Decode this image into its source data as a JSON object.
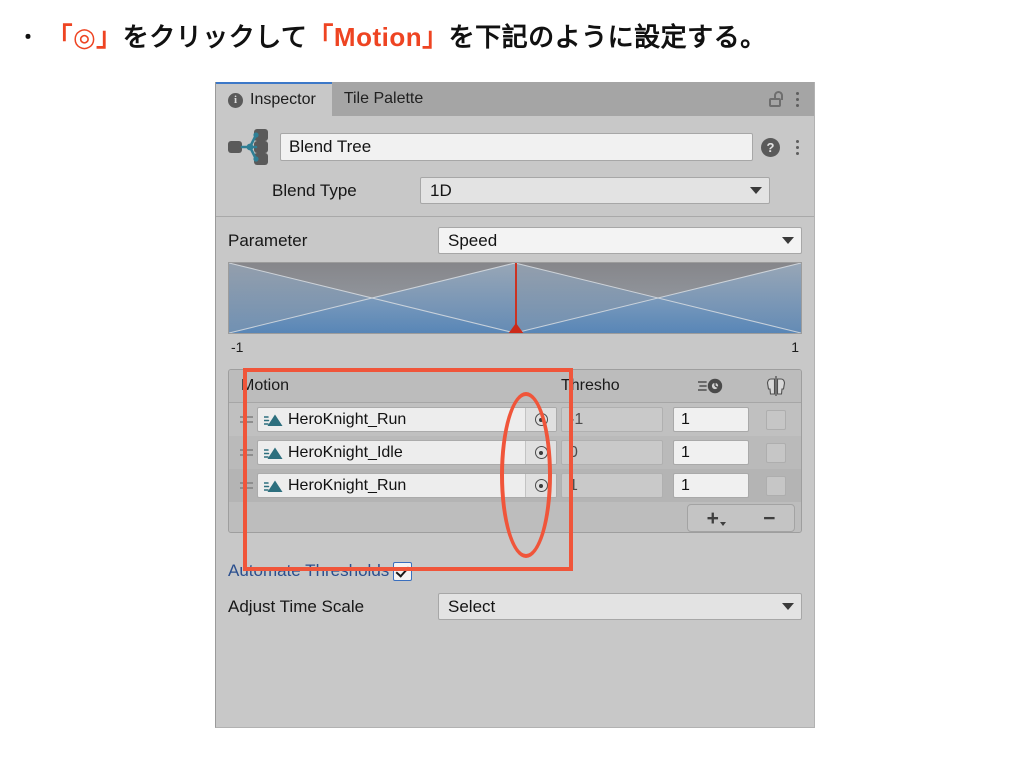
{
  "caption": {
    "bullet": "・",
    "part1_red": "「◎」",
    "part2": "をクリックして",
    "part3_red": "「Motion」",
    "part4": "を下記のように設定する。",
    "accent_color": "#ee4422"
  },
  "inspector": {
    "tabs": [
      {
        "label": "Inspector",
        "icon": "info-icon",
        "active": true
      },
      {
        "label": "Tile Palette",
        "icon": "",
        "active": false
      }
    ],
    "lock_icon": "lock-open-icon",
    "menu_icon": "kebab-menu-icon",
    "header": {
      "asset_icon": "blend-tree-icon",
      "name_value": "Blend Tree",
      "help_icon": "help-icon",
      "menu_icon": "kebab-menu-icon",
      "blend_type_label": "Blend Type",
      "blend_type_value": "1D"
    },
    "parameter": {
      "label": "Parameter",
      "value": "Speed",
      "axis_min": "-1",
      "axis_max": "1"
    },
    "motion_table": {
      "columns": {
        "motion": "Motion",
        "threshold": "Thresho",
        "speed_icon": "speed-clock-icon",
        "mirror_icon": "mirror-avatar-icon"
      },
      "rows": [
        {
          "drag_handle": "drag-handle-icon",
          "clip_icon": "animation-clip-icon",
          "motion": "HeroKnight_Run",
          "picker_icon": "object-picker-icon",
          "threshold": "-1",
          "speed": "1",
          "mirror_checked": false
        },
        {
          "drag_handle": "drag-handle-icon",
          "clip_icon": "animation-clip-icon",
          "motion": "HeroKnight_Idle",
          "picker_icon": "object-picker-icon",
          "threshold": "0",
          "speed": "1",
          "mirror_checked": false
        },
        {
          "drag_handle": "drag-handle-icon",
          "clip_icon": "animation-clip-icon",
          "motion": "HeroKnight_Run",
          "picker_icon": "object-picker-icon",
          "threshold": "1",
          "speed": "1",
          "mirror_checked": false
        }
      ],
      "add_label": "+",
      "remove_label": "−"
    },
    "automate_thresholds": {
      "label": "Automate Thresholds",
      "checked": true
    },
    "adjust_time_scale": {
      "label": "Adjust Time Scale",
      "value": "Select"
    }
  },
  "annotations": {
    "rect_color": "#f0553a",
    "ellipse_color": "#f0553a"
  }
}
